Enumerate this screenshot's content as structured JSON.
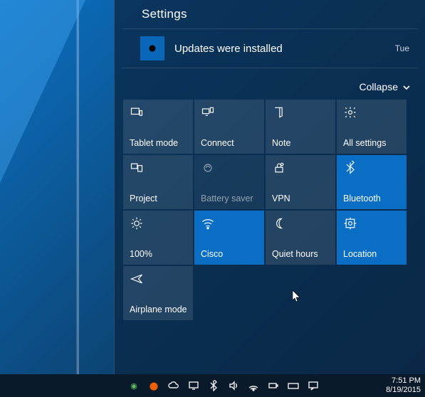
{
  "header": {
    "title": "Settings"
  },
  "notification": {
    "message": "Updates were installed",
    "day": "Tue",
    "icon_name": "gear-icon"
  },
  "collapse": {
    "label": "Collapse"
  },
  "tiles": [
    {
      "id": "tablet-mode",
      "label": "Tablet mode",
      "icon": "tablet-icon",
      "active": false,
      "dim": false
    },
    {
      "id": "connect",
      "label": "Connect",
      "icon": "connect-icon",
      "active": false,
      "dim": false
    },
    {
      "id": "note",
      "label": "Note",
      "icon": "note-icon",
      "active": false,
      "dim": false
    },
    {
      "id": "all-settings",
      "label": "All settings",
      "icon": "settings-icon",
      "active": false,
      "dim": false
    },
    {
      "id": "project",
      "label": "Project",
      "icon": "project-icon",
      "active": false,
      "dim": false
    },
    {
      "id": "battery-saver",
      "label": "Battery saver",
      "icon": "battery-icon",
      "active": false,
      "dim": true
    },
    {
      "id": "vpn",
      "label": "VPN",
      "icon": "vpn-icon",
      "active": false,
      "dim": false
    },
    {
      "id": "bluetooth",
      "label": "Bluetooth",
      "icon": "bluetooth-icon",
      "active": true,
      "dim": false
    },
    {
      "id": "brightness",
      "label": "100%",
      "icon": "brightness-icon",
      "active": false,
      "dim": false
    },
    {
      "id": "wifi",
      "label": "Cisco",
      "icon": "wifi-icon",
      "active": true,
      "dim": false
    },
    {
      "id": "quiet-hours",
      "label": "Quiet hours",
      "icon": "moon-icon",
      "active": false,
      "dim": false
    },
    {
      "id": "location",
      "label": "Location",
      "icon": "location-icon",
      "active": true,
      "dim": false
    },
    {
      "id": "airplane",
      "label": "Airplane mode",
      "icon": "airplane-icon",
      "active": false,
      "dim": false
    }
  ],
  "taskbar": {
    "time": "7:51 PM",
    "date": "8/19/2015"
  }
}
